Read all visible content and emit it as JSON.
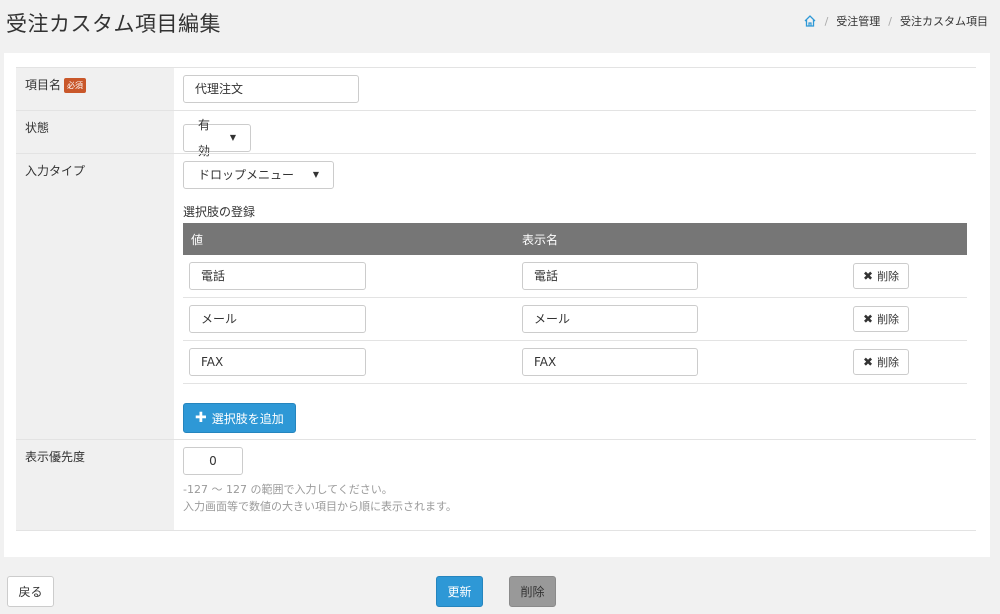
{
  "header": {
    "title": "受注カスタム項目編集",
    "breadcrumb": [
      "受注管理",
      "受注カスタム項目"
    ]
  },
  "form": {
    "name": {
      "label": "項目名",
      "required_badge": "必須",
      "value": "代理注文"
    },
    "status": {
      "label": "状態",
      "selected": "有効"
    },
    "input_type": {
      "label": "入力タイプ",
      "selected": "ドロップメニュー",
      "options_title": "選択肢の登録",
      "columns": [
        "値",
        "表示名"
      ],
      "options": [
        {
          "value": "電話",
          "display": "電話",
          "delete_label": "削除"
        },
        {
          "value": "メール",
          "display": "メール",
          "delete_label": "削除"
        },
        {
          "value": "FAX",
          "display": "FAX",
          "delete_label": "削除"
        }
      ],
      "add_label": "選択肢を追加"
    },
    "priority": {
      "label": "表示優先度",
      "value": "0",
      "help_line1": "-127 ～ 127 の範囲で入力してください。",
      "help_line2": "入力画面等で数値の大きい項目から順に表示されます。"
    }
  },
  "footer": {
    "back_label": "戻る",
    "update_label": "更新",
    "delete_label": "削除"
  },
  "colors": {
    "primary": "#2e98d6",
    "required_badge": "#c9572a",
    "table_header": "#767676",
    "delete_button": "#999999"
  }
}
